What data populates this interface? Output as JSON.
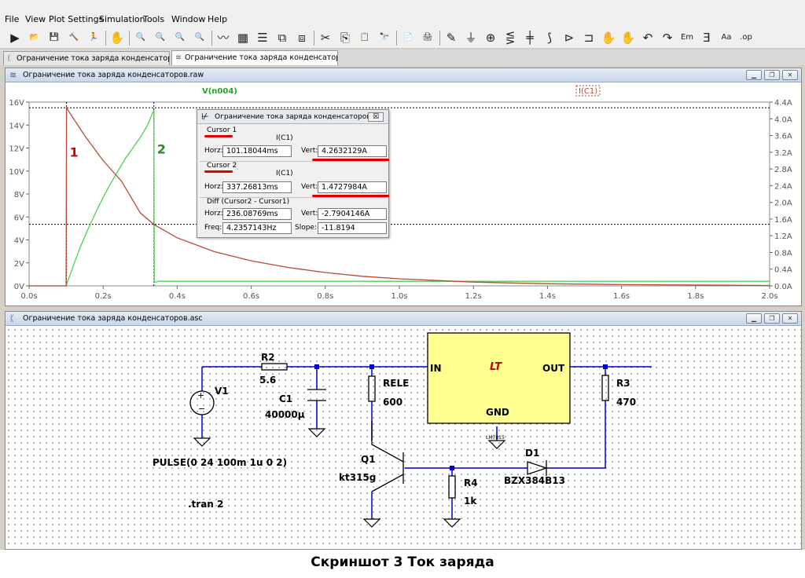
{
  "menu": [
    {
      "label": "File"
    },
    {
      "label": "View"
    },
    {
      "label": "Plot Settings"
    },
    {
      "label": "Simulation"
    },
    {
      "label": "Tools"
    },
    {
      "label": "Window"
    },
    {
      "label": "Help"
    }
  ],
  "toolbar": {
    "icons": [
      "run-icon",
      "open-icon",
      "save-icon",
      "control-panel-icon",
      "halt-icon",
      "pan-hand-icon",
      "zoom-in-icon",
      "zoom-out-icon",
      "zoom-full-icon",
      "zoom-cancel-icon",
      "autorange-icon",
      "grid-icon",
      "tile-horizontal-icon",
      "tile-vertical-icon",
      "cascade-icon",
      "cut-icon",
      "copy-icon",
      "paste-icon",
      "find-icon",
      "print-preview-icon",
      "print-icon",
      "wire-icon",
      "ground-icon",
      "label-icon",
      "resistor-icon",
      "capacitor-icon",
      "inductor-icon",
      "diode-icon",
      "component-icon",
      "move-icon",
      "drag-icon",
      "undo-icon",
      "redo-icon",
      "rotate-icon",
      "mirror-icon",
      "text-icon",
      "spice-directive-icon"
    ],
    "glyphs": [
      "▶",
      "📂",
      "💾",
      "🔨",
      "🏃",
      "✋",
      "🔍",
      "🔍",
      "🔍",
      "🔍",
      "〰",
      "▦",
      "☰",
      "⧉",
      "⧈",
      "✂",
      "⎘",
      "📋",
      "🔭",
      "📄",
      "🖨",
      "✎",
      "⏚",
      "⊕",
      "⋚",
      "╪",
      "⟆",
      "⊳",
      "⊐",
      "✋",
      "✋",
      "↶",
      "↷",
      "Em",
      "Ǝ",
      "Aa",
      ".op"
    ],
    "separator_after": [
      4,
      5,
      9,
      14,
      18,
      20
    ]
  },
  "tabs": [
    {
      "label": "Ограничение тока заряда конденсаторов.asc",
      "active": false
    },
    {
      "label": "Ограничение тока заряда конденсаторов.raw",
      "active": true
    }
  ],
  "waveform_window": {
    "title": "Ограничение тока заряда конденсаторов.raw",
    "trace_labels": {
      "voltage": "V(n004)",
      "current": "I(C1)"
    },
    "annotations": {
      "cursor1": "1",
      "cursor2": "2"
    },
    "colors": {
      "voltage": "#4fcf4f",
      "current": "#b84a3a",
      "cursor": "#000000",
      "red_mark": "#dd0000",
      "green_mark": "#2a8a2a"
    }
  },
  "chart_data": {
    "type": "line",
    "title": "",
    "xlabel": "",
    "ylabel_left": "",
    "ylabel_right": "",
    "xlim": [
      0,
      2.0
    ],
    "ylim_left": [
      0,
      16
    ],
    "ylim_right": [
      0,
      4.4
    ],
    "x_ticks": [
      "0.0s",
      "0.2s",
      "0.4s",
      "0.6s",
      "0.8s",
      "1.0s",
      "1.2s",
      "1.4s",
      "1.6s",
      "1.8s",
      "2.0s"
    ],
    "y_left_ticks": [
      "0V",
      "2V",
      "4V",
      "6V",
      "8V",
      "10V",
      "12V",
      "14V",
      "16V"
    ],
    "y_right_ticks": [
      "0.0A",
      "0.4A",
      "0.8A",
      "1.2A",
      "1.6A",
      "2.0A",
      "2.4A",
      "2.8A",
      "3.2A",
      "3.6A",
      "4.0A",
      "4.4A"
    ],
    "grid": false,
    "cursors": [
      {
        "name": "Cursor 1",
        "x": 0.101,
        "y": 4.263
      },
      {
        "name": "Cursor 2",
        "x": 0.337,
        "y": 1.473
      }
    ],
    "series": [
      {
        "name": "V(n004)",
        "axis": "left",
        "x": [
          0,
          0.1,
          0.11,
          0.12,
          0.14,
          0.16,
          0.18,
          0.2,
          0.22,
          0.24,
          0.26,
          0.28,
          0.3,
          0.32,
          0.337,
          0.338,
          0.35,
          0.4,
          0.6,
          1.0,
          1.5,
          2.0
        ],
        "y": [
          0,
          0,
          0.9,
          1.8,
          3.5,
          5.0,
          6.4,
          7.7,
          8.9,
          10.0,
          11.1,
          12.0,
          12.9,
          14.0,
          15.3,
          0.3,
          0.4,
          0.4,
          0.4,
          0.4,
          0.4,
          0.4
        ]
      },
      {
        "name": "I(C1)",
        "axis": "right",
        "x": [
          0,
          0.1,
          0.101,
          0.15,
          0.2,
          0.25,
          0.3,
          0.337,
          0.4,
          0.5,
          0.6,
          0.7,
          0.8,
          0.9,
          1.0,
          1.2,
          1.4,
          1.6,
          1.8,
          2.0
        ],
        "y": [
          0,
          0,
          4.26,
          3.6,
          3.0,
          2.5,
          1.75,
          1.47,
          1.15,
          0.82,
          0.6,
          0.44,
          0.32,
          0.23,
          0.17,
          0.09,
          0.05,
          0.03,
          0.02,
          0.01
        ]
      }
    ]
  },
  "cursor_dialog": {
    "title": "Ограничение тока заряда конденсаторов...",
    "close": "☒",
    "cursor1": {
      "label": "Cursor 1",
      "trace": "I(C1)",
      "horz_label": "Horz:",
      "horz": "101.18044ms",
      "vert_label": "Vert:",
      "vert": "4.2632129A"
    },
    "cursor2": {
      "label": "Cursor 2",
      "trace": "I(C1)",
      "horz_label": "Horz:",
      "horz": "337.26813ms",
      "vert_label": "Vert:",
      "vert": "1.4727984A"
    },
    "diff": {
      "label": "Diff (Cursor2 - Cursor1)",
      "horz_label": "Horz:",
      "horz": "236.08769ms",
      "vert_label": "Vert:",
      "vert": "-2.7904146A",
      "freq_label": "Freq:",
      "freq": "4.2357143Hz",
      "slope_label": "Slope:",
      "slope": "-11.8194"
    }
  },
  "schematic_window": {
    "title": "Ограничение тока заряда конденсаторов.asc",
    "labels": {
      "v1": "V1",
      "r2": "R2",
      "r2_val": "5.6",
      "c1": "C1",
      "c1_val": "40000µ",
      "rele": "RELE",
      "rele_val": "600",
      "in": "IN",
      "out": "OUT",
      "gnd": "GND",
      "reg_part": "LM7815",
      "r3": "R3",
      "r3_val": "470",
      "q1": "Q1",
      "q1_val": "kt315g",
      "r4": "R4",
      "r4_val": "1k",
      "d1": "D1",
      "d1_val": "BZX384B13",
      "pulse": "PULSE(0 24 100m 1u 0 2)",
      "tran": ".tran 2",
      "logo": "LT"
    },
    "colors": {
      "wire": "#0000c8",
      "component": "#000000",
      "regulator_fill": "#ffff90",
      "junction": "#0000c8"
    }
  },
  "window_buttons": {
    "minimize": "▁",
    "restore": "❐",
    "close": "✕"
  },
  "caption": "Скриншот 3 Ток заряда"
}
